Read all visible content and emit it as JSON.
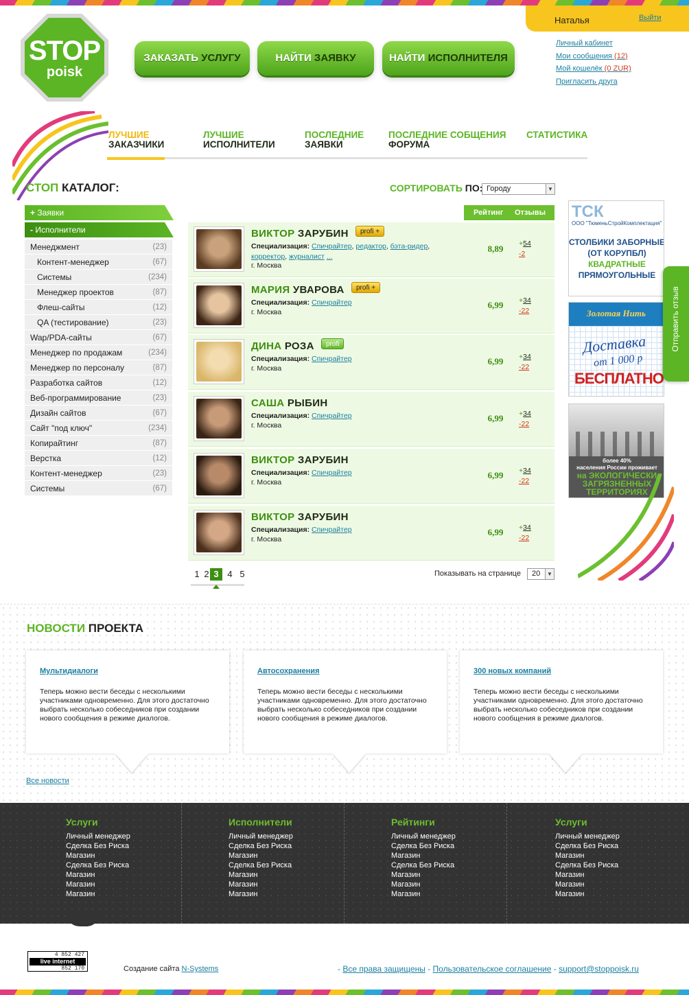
{
  "header": {
    "logo": {
      "line1": "STOP",
      "line2": "poisk"
    },
    "buttons": [
      {
        "part1": "ЗАКАЗАТЬ ",
        "part2": "УСЛУГУ"
      },
      {
        "part1": "НАЙТИ ",
        "part2": "ЗАЯВКУ"
      },
      {
        "part1": "НАЙТИ ",
        "part2": "ИСПОЛНИТЕЛЯ"
      }
    ],
    "user": {
      "name": "Наталья",
      "logout": "Выйти",
      "links": {
        "cabinet": "Личный кабинет",
        "messages": "Мои сообщения",
        "messages_count": "(12)",
        "wallet": "Мой кошелёк",
        "wallet_amount": "(0 ZUR)",
        "invite": "Пригласить друга"
      }
    }
  },
  "nav": [
    {
      "g": "ЛУЧШИЕ",
      "d": "ЗАКАЗЧИКИ"
    },
    {
      "g": "ЛУЧШИЕ",
      "d": "ИСПОЛНИТЕЛИ"
    },
    {
      "g": "ПОСЛЕДНИЕ",
      "d": "ЗАЯВКИ"
    },
    {
      "g": "ПОСЛЕДНИЕ СОБЩЕНИЯ",
      "d": "ФОРУМА"
    },
    {
      "g": "СТАТИСТИКА",
      "d": ""
    }
  ],
  "catalog": {
    "title_g": "СТОП ",
    "title_d": "КАТАЛОГ:"
  },
  "sort": {
    "label_g": "СОРТИРОВАТЬ ",
    "label_d": "ПО:",
    "value": "Городу"
  },
  "sidebar": {
    "head1": "Заявки",
    "head1_sign": "+",
    "head2": "Исполнители",
    "head2_sign": "-",
    "items": [
      {
        "label": "Менеджмент",
        "count": "(23)"
      },
      {
        "label": "Контент-менеджер",
        "count": "(67)"
      },
      {
        "label": "Системы",
        "count": "(234)"
      },
      {
        "label": "Менеджер проектов",
        "count": "(87)"
      },
      {
        "label": "Флеш-сайты",
        "count": "(12)"
      },
      {
        "label": "QA (тестирование)",
        "count": "(23)"
      },
      {
        "label": "Wap/PDA-сайты",
        "count": "(67)"
      },
      {
        "label": "Менеджер по продажам",
        "count": "(234)"
      },
      {
        "label": "Менеджер по персоналу",
        "count": "(87)"
      },
      {
        "label": "Разработка сайтов",
        "count": "(12)"
      },
      {
        "label": "Веб-программирование",
        "count": "(23)"
      },
      {
        "label": "Дизайн сайтов",
        "count": "(67)"
      },
      {
        "label": "Сайт \"под ключ\"",
        "count": "(234)"
      },
      {
        "label": "Копирайтинг",
        "count": "(87)"
      },
      {
        "label": "Верстка",
        "count": "(12)"
      },
      {
        "label": "Контент-менеджер",
        "count": "(23)"
      },
      {
        "label": "Системы",
        "count": "(67)"
      }
    ]
  },
  "table": {
    "col_rating": "Рейтинг",
    "col_reviews": "Отзывы",
    "spec_label": "Специализация:",
    "rows": [
      {
        "first": "ВИКТОР",
        "last": "ЗАРУБИН",
        "badge": "profi +",
        "spec1": "Спичрайтер",
        "spec2": "редактор",
        "spec3": "бэта-ридер",
        "spec4": "корректор",
        "spec5": "журналист",
        "more": "...",
        "city": "г. Москва",
        "rating": "8,89",
        "plus": "+",
        "plus_n": "54",
        "minus": "-2"
      },
      {
        "first": "МАРИЯ",
        "last": "УВАРОВА",
        "badge": "profi +",
        "spec1": "Спичрайтер",
        "city": "г. Москва",
        "rating": "6,99",
        "plus": "+",
        "plus_n": "34",
        "minus": "-22"
      },
      {
        "first": "ДИНА",
        "last": "РОЗА",
        "badge": "profi",
        "spec1": "Спичрайтер",
        "city": "г. Москва",
        "rating": "6,99",
        "plus": "+",
        "plus_n": "34",
        "minus": "-22"
      },
      {
        "first": "САША",
        "last": "РЫБИН",
        "spec1": "Спичрайтер",
        "city": "г. Москва",
        "rating": "6,99",
        "plus": "+",
        "plus_n": "34",
        "minus": "-22"
      },
      {
        "first": "ВИКТОР",
        "last": "ЗАРУБИН",
        "spec1": "Спичрайтер",
        "city": "г. Москва",
        "rating": "6,99",
        "plus": "+",
        "plus_n": "34",
        "minus": "-22"
      },
      {
        "first": "ВИКТОР",
        "last": "ЗАРУБИН",
        "spec1": "Спичрайтер",
        "city": "г. Москва",
        "rating": "6,99",
        "plus": "+",
        "plus_n": "34",
        "minus": "-22"
      }
    ]
  },
  "pager": {
    "pages": [
      "1",
      "2",
      "3",
      "4",
      "5"
    ],
    "current": "3",
    "perpage_label": "Показывать на странице",
    "perpage_value": "20"
  },
  "ads": {
    "ad1": {
      "brand": "ТСК",
      "company": "ООО \"ТюменьСтройКомплектация\"",
      "l1": "СТОЛБИКИ ЗАБОРНЫЕ",
      "l2": "(ОТ КОРУПБЛ)",
      "l3": "КВАДРАТНЫЕ",
      "l4": "ПРЯМОУГОЛЬНЫЕ"
    },
    "ad2": {
      "brand": "Золотая Нить",
      "l1": "Доставка",
      "l2": "от 1 000 р",
      "l3": "БЕСПЛАТНО"
    },
    "ad3": {
      "l1": "более 40%",
      "l2": "населения России проживает",
      "l3": "на ЭКОЛОГИЧЕСКИ",
      "l4": "ЗАГРЯЗНЕННЫХ",
      "l5": "ТЕРРИТОРИЯХ"
    }
  },
  "feedback": "Отправить отзыв",
  "news": {
    "title_g": "НОВОСТИ ",
    "title_d": "ПРОЕКТА",
    "items": [
      {
        "title": "Мультидиалоги",
        "body": "Теперь можно вести беседы с несколькими участниками одновременно. Для этого достаточно выбрать несколько собеседников при создании нового сообщения в режиме диалогов."
      },
      {
        "title": "Автосохранения",
        "body": "Теперь можно вести беседы с несколькими участниками одновременно. Для этого достаточно выбрать несколько собеседников при создании нового сообщения в режиме диалогов."
      },
      {
        "title": "300 новых компаний",
        "body": "Теперь можно вести беседы с несколькими участниками одновременно. Для этого достаточно выбрать несколько собеседников при создании нового сообщения в режиме диалогов."
      }
    ],
    "all": "Все новости"
  },
  "footer": {
    "cols": [
      {
        "title": "Услуги",
        "links": [
          "Личный менеджер",
          "Сделка Без Риска",
          "Магазин",
          "Сделка Без Риска",
          "Магазин",
          "Магазин",
          "Магазин"
        ]
      },
      {
        "title": "Исполнители",
        "links": [
          "Личный менеджер",
          "Сделка Без Риска",
          "Магазин",
          "Сделка Без Риска",
          "Магазин",
          "Магазин",
          "Магазин"
        ]
      },
      {
        "title": "Рейтинги",
        "links": [
          "Личный менеджер",
          "Сделка Без Риска",
          "Магазин",
          "Сделка Без Риска",
          "Магазин",
          "Магазин",
          "Магазин"
        ]
      },
      {
        "title": "Услуги",
        "links": [
          "Личный менеджер",
          "Сделка Без Риска",
          "Магазин",
          "Сделка Без Риска",
          "Магазин",
          "Магазин",
          "Магазин"
        ]
      }
    ],
    "counter": {
      "top": "4 852 427",
      "mid": "live internet",
      "bottom": "852 170"
    },
    "created": "Создание сайта ",
    "created_link": "N-Systems",
    "links": [
      "Все права защищены",
      "Пользовательское соглашение",
      "support@stoppoisk.ru"
    ]
  }
}
